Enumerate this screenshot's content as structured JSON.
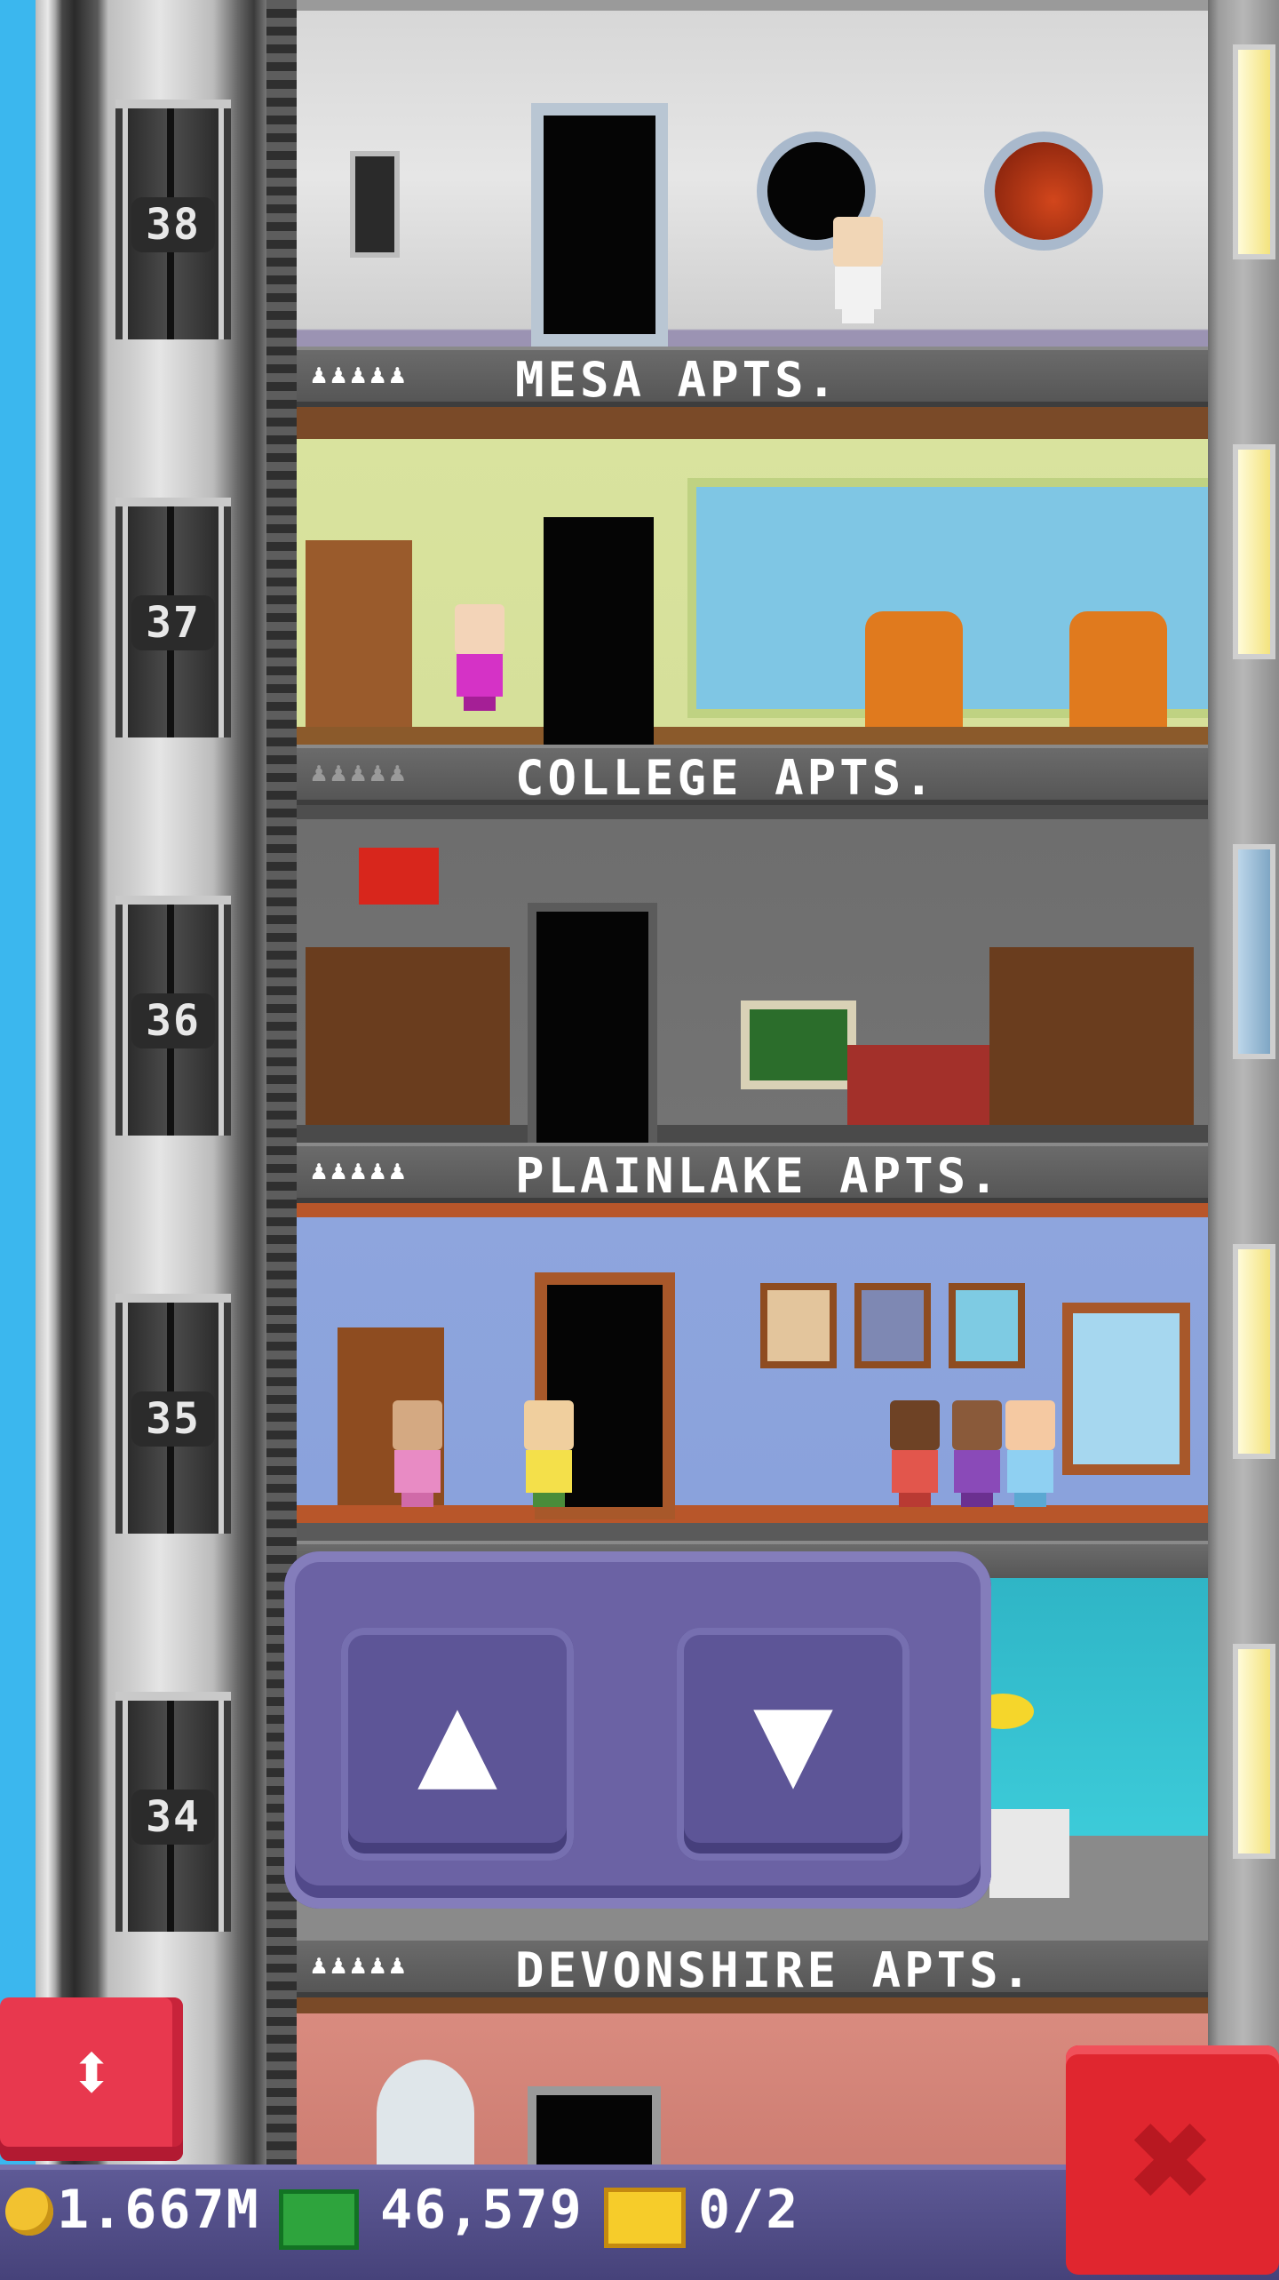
{
  "elevator": {
    "floor_numbers": [
      "38",
      "37",
      "36",
      "35",
      "34"
    ]
  },
  "floors": [
    {
      "name": "MESA APTS.",
      "residents_icon": "♟♟♟♟♟",
      "residents_lit": true
    },
    {
      "name": "COLLEGE APTS.",
      "residents_icon": "♟♟♟♟♟",
      "residents_lit": false
    },
    {
      "name": "PLAINLAKE APTS.",
      "residents_icon": "♟♟♟♟♟",
      "residents_lit": true
    },
    {
      "name": "DEVONSHIRE APTS.",
      "residents_icon": "♟♟♟♟♟",
      "residents_lit": true
    }
  ],
  "controls": {
    "up_glyph": "▲",
    "down_glyph": "▼",
    "elevator_glyph": "⬍",
    "close_glyph": "✖"
  },
  "status_bar": {
    "coins": "1.667M",
    "bux": "46,579",
    "tickets": "0/2",
    "coin_icon": "coin-icon",
    "bux_icon": "bux-icon",
    "ticket_icon": "ticket-icon"
  },
  "colors": {
    "control_purple": "#6b62a4",
    "close_red": "#e0262f",
    "elevator_red": "#e8384e",
    "status_bar": "#4f4b86"
  }
}
